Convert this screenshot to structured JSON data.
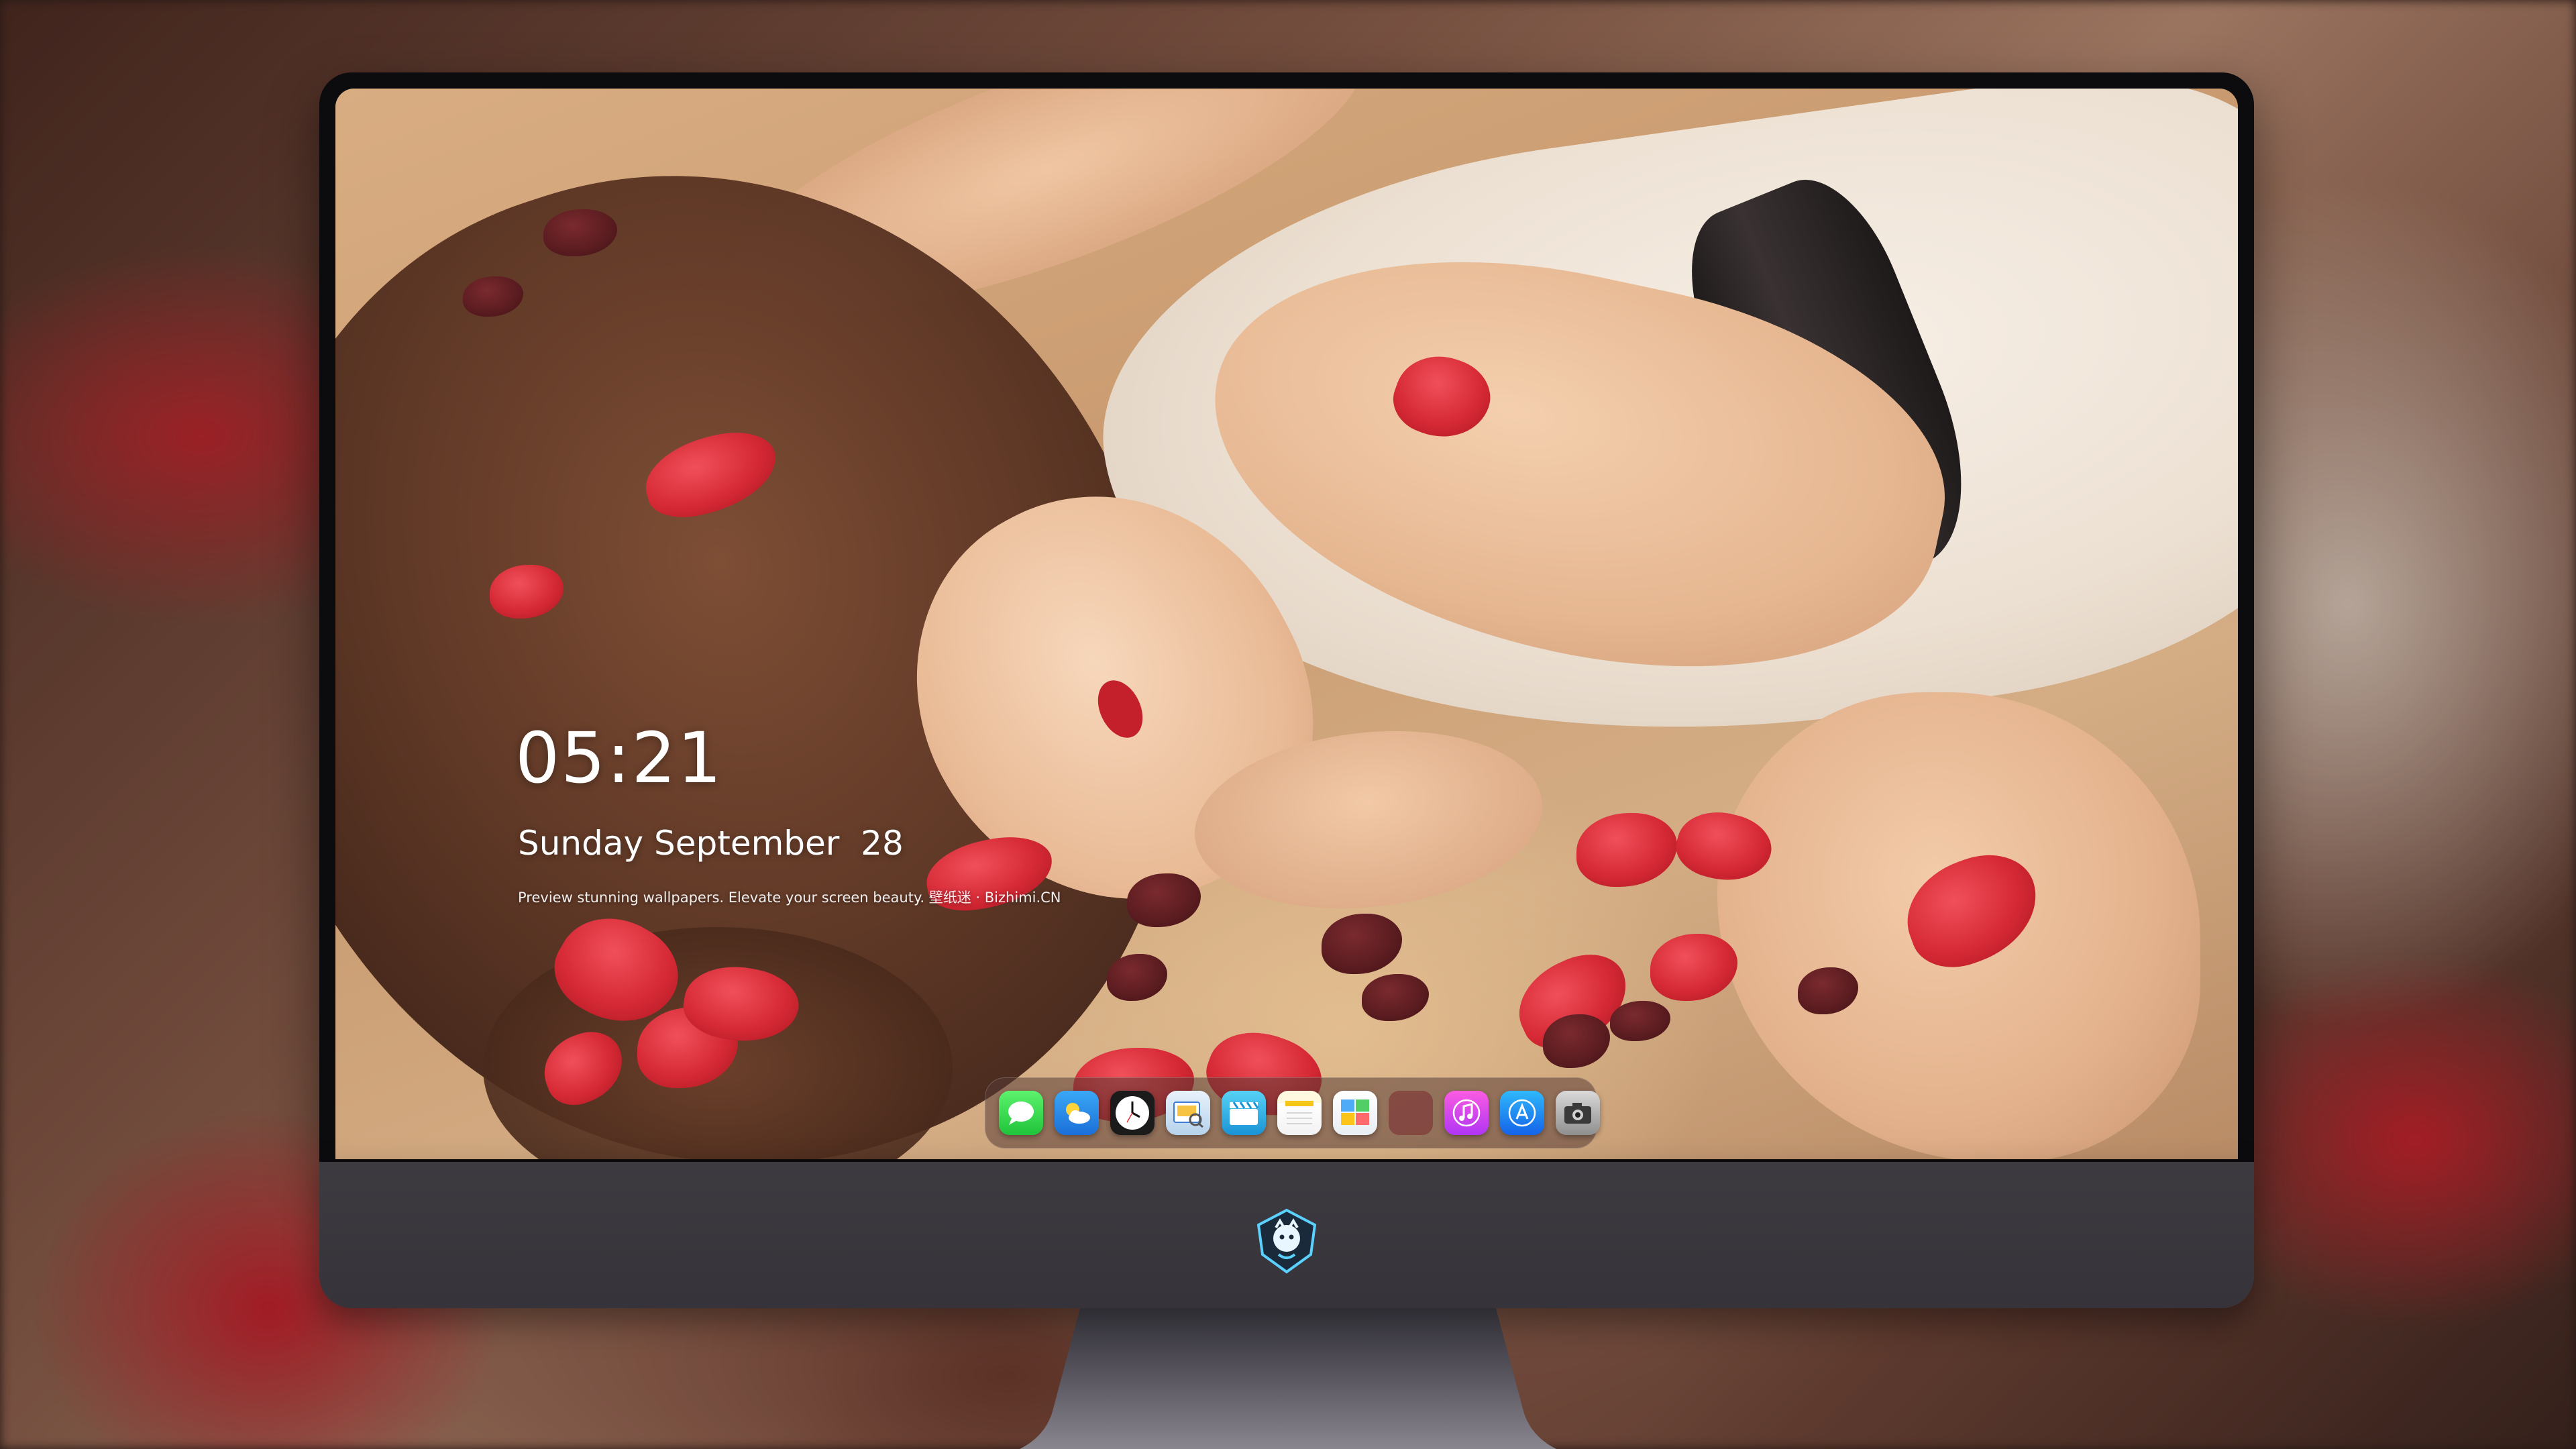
{
  "lockscreen": {
    "time": "05:21",
    "date": "Sunday September  28",
    "tagline": "Preview stunning wallpapers. Elevate your screen beauty. 壁纸迷 · Bizhimi.CN"
  },
  "dock": {
    "icons": [
      {
        "name": "messages-icon"
      },
      {
        "name": "weather-icon"
      },
      {
        "name": "clock-icon"
      },
      {
        "name": "preview-icon"
      },
      {
        "name": "clips-icon"
      },
      {
        "name": "notes-icon"
      },
      {
        "name": "photo-booth-icon"
      },
      {
        "name": "music-icon"
      },
      {
        "name": "app-store-icon"
      },
      {
        "name": "camera-icon"
      }
    ]
  },
  "monitor": {
    "chin_logo": "bizhimi-logo"
  },
  "colors": {
    "clock_text": "#ffffff",
    "bezel": "#0c0c0e",
    "chin": "#3d3a40",
    "dock_bg": "rgba(90,60,55,0.55)"
  }
}
